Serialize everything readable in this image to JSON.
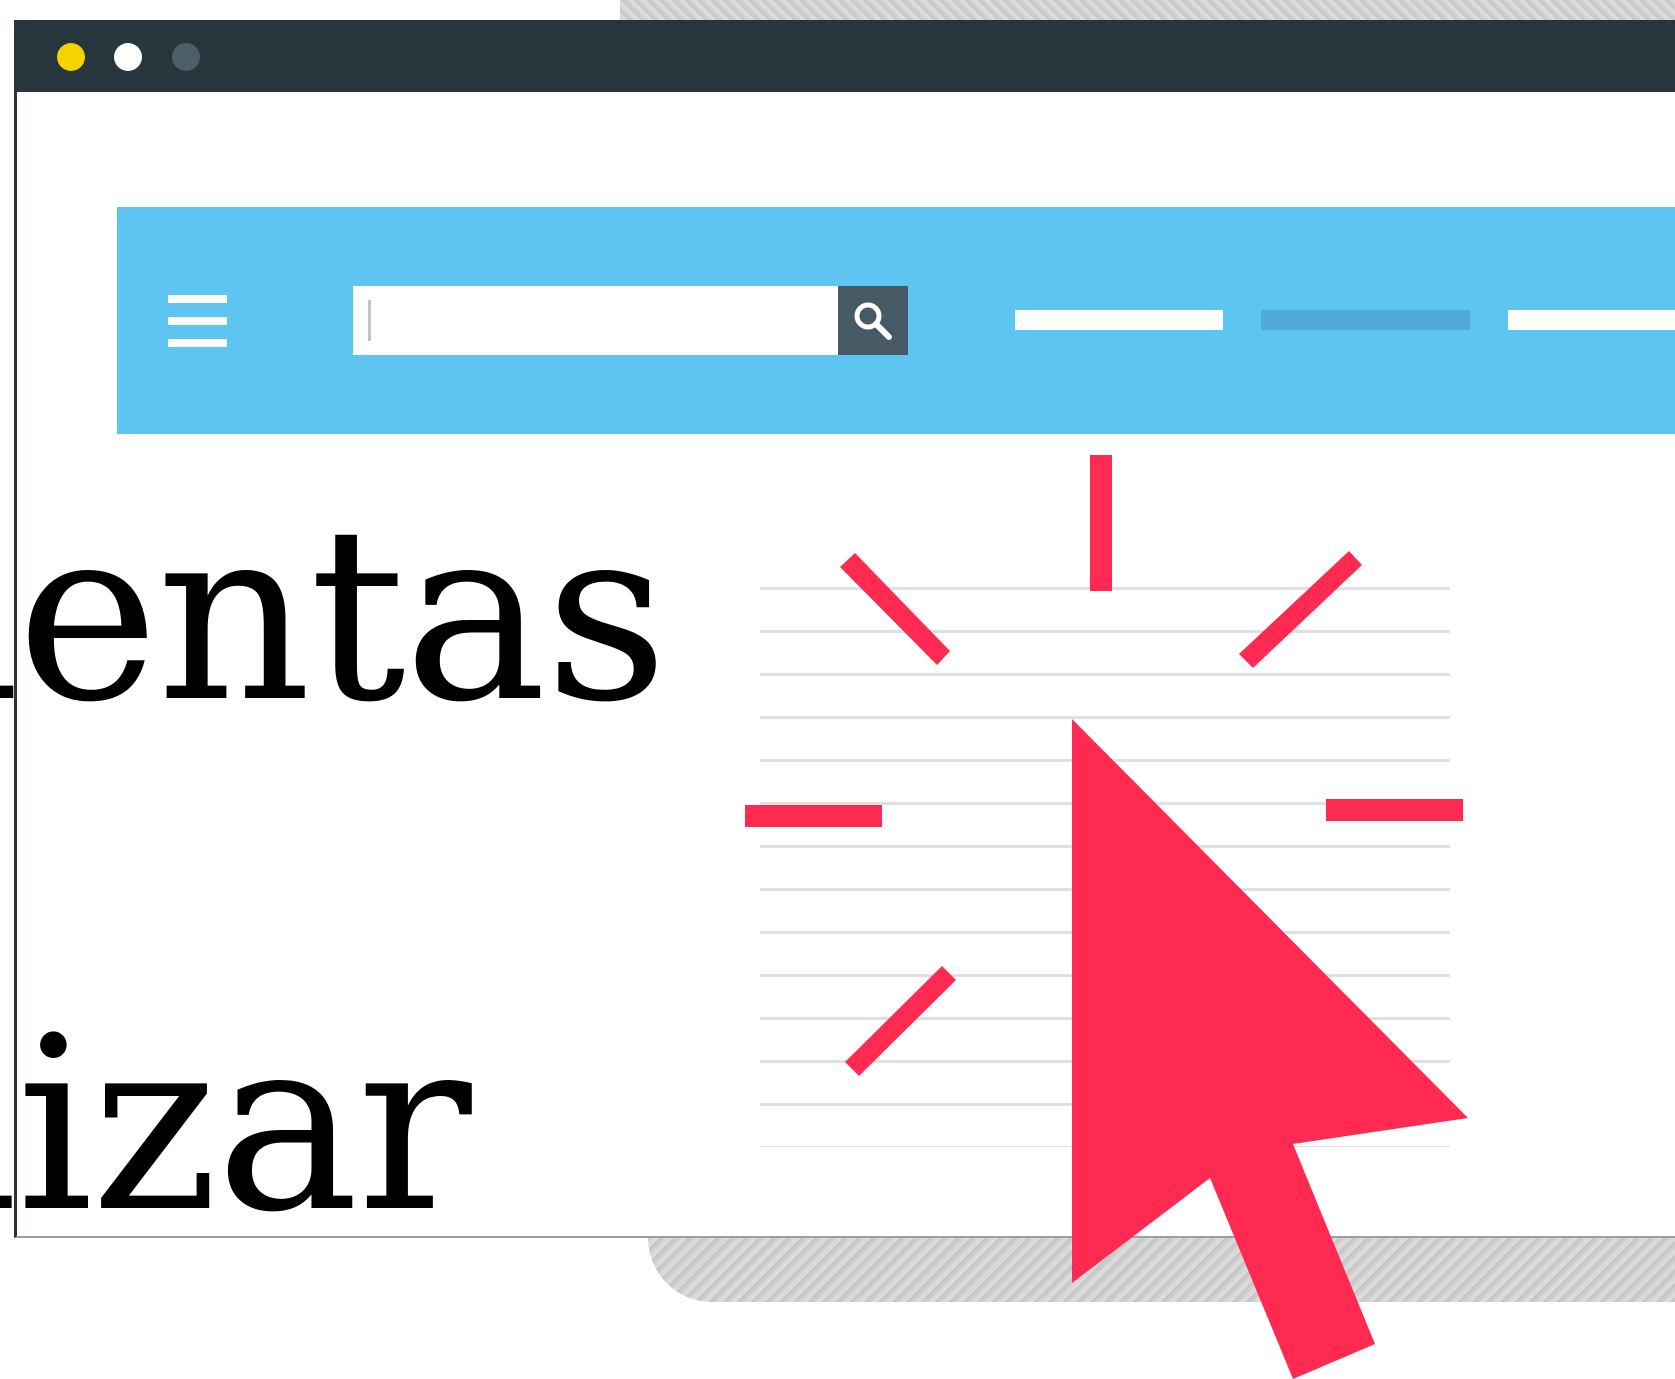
{
  "window": {
    "controls": [
      "yellow-dot",
      "white-dot",
      "gray-dot"
    ]
  },
  "navbar": {
    "menu_icon": "hamburger-menu-icon",
    "search": {
      "value": "",
      "placeholder": "",
      "button_icon": "search-icon"
    }
  },
  "headline": {
    "line1": "ientas",
    "line2": "lizar"
  },
  "graphic": {
    "pointer_icon": "mouse-pointer-click-icon"
  },
  "colors": {
    "titlebar": "#27353d",
    "dot_yellow": "#f6d200",
    "dot_white": "#ffffff",
    "dot_gray": "#4b5f69",
    "navbar": "#5ec4f2",
    "search_button": "#455a64",
    "nav_link_active": "#50acd6",
    "pointer": "#ff2a51",
    "text": "#000000"
  }
}
